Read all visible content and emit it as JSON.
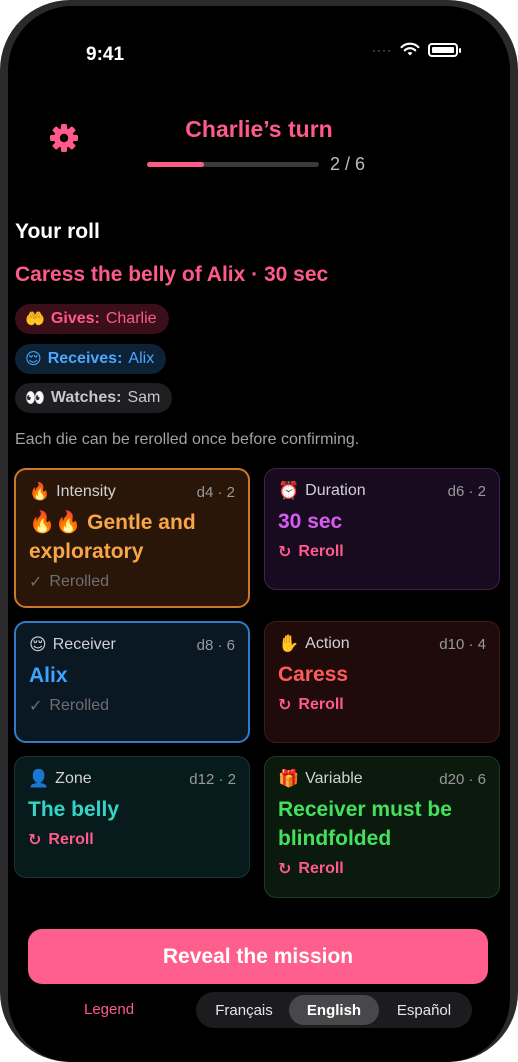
{
  "status_bar": {
    "time": "9:41",
    "signal": "····"
  },
  "header": {
    "title": "Charlie’s turn",
    "progress_text": "2 / 6",
    "progress_fraction": 0.333
  },
  "roll": {
    "heading": "Your roll",
    "mission": "Caress the belly of Alix · 30 sec",
    "roles": [
      {
        "emoji": "🤲",
        "key": "Gives:",
        "value": "Charlie"
      },
      {
        "emoji": "😌",
        "key": "Receives:",
        "value": "Alix"
      },
      {
        "emoji": "👀",
        "key": "Watches:",
        "value": "Sam"
      }
    ],
    "hint": "Each die can be rerolled once before confirming."
  },
  "dice": [
    {
      "icon": "🔥",
      "label": "Intensity",
      "die": "d4 · 2",
      "value": "🔥🔥 Gentle and exploratory",
      "foot_icon": "✓",
      "foot": "Rerolled",
      "color": "#f7a648"
    },
    {
      "icon": "⏰",
      "label": "Duration",
      "die": "d6 · 2",
      "value": "30 sec",
      "foot_icon": "↻",
      "foot": "Reroll",
      "color": "#d55df2"
    },
    {
      "icon": "😌",
      "label": "Receiver",
      "die": "d8 · 6",
      "value": "Alix",
      "foot_icon": "✓",
      "foot": "Rerolled",
      "color": "#3fa2ff"
    },
    {
      "icon": "✋",
      "label": "Action",
      "die": "d10 · 4",
      "value": "Caress",
      "foot_icon": "↻",
      "foot": "Reroll",
      "color": "#ff5a5a"
    },
    {
      "icon": "👤",
      "label": "Zone",
      "die": "d12 · 2",
      "value": "The belly",
      "foot_icon": "↻",
      "foot": "Reroll",
      "color": "#33d6c6"
    },
    {
      "icon": "🎁",
      "label": "Variable",
      "die": "d20 · 6",
      "value": "Receiver must be blindfolded",
      "foot_icon": "↻",
      "foot": "Reroll",
      "color": "#46e05e"
    }
  ],
  "actions": {
    "reveal": "Reveal the mission",
    "legend": "Legend"
  },
  "languages": {
    "options": [
      "Français",
      "English",
      "Español"
    ],
    "selected": "English"
  },
  "colors": {
    "accent": "#ff5a8a",
    "background": "#000000"
  }
}
